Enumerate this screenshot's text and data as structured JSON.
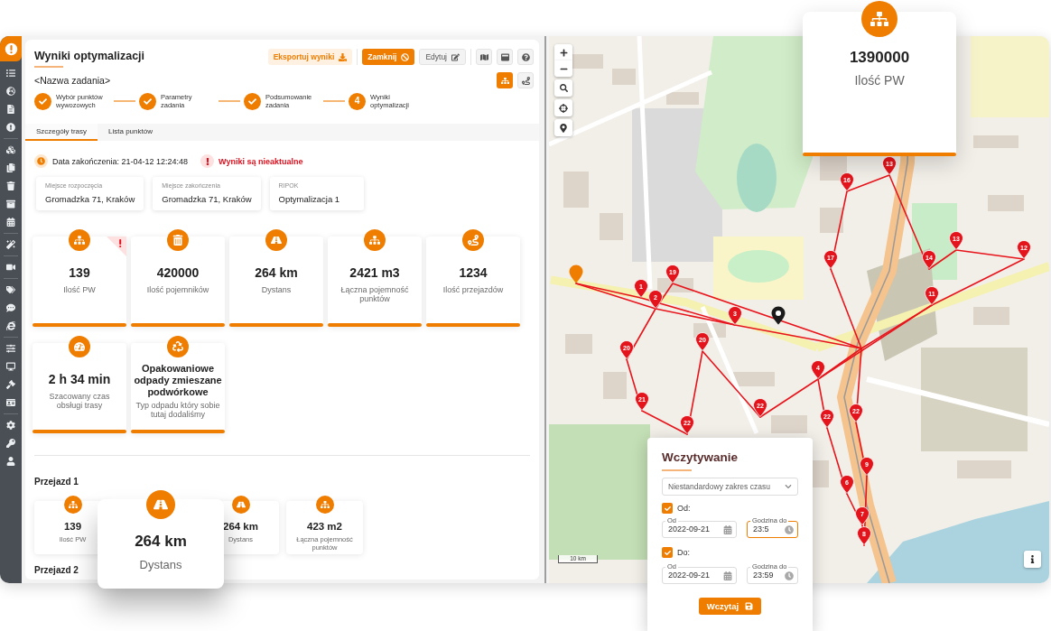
{
  "sidebar": {
    "groups": [
      {
        "items": [
          {
            "kind": "list"
          },
          {
            "kind": "globe"
          },
          {
            "kind": "file"
          },
          {
            "kind": "alert"
          }
        ]
      },
      {
        "items": [
          {
            "kind": "cubes"
          },
          {
            "kind": "copy"
          },
          {
            "kind": "trash"
          },
          {
            "kind": "archive"
          },
          {
            "kind": "calendar"
          }
        ]
      },
      {
        "items": [
          {
            "kind": "wand"
          }
        ]
      },
      {
        "items": [
          {
            "kind": "video"
          }
        ]
      },
      {
        "items": [
          {
            "kind": "tags"
          },
          {
            "kind": "comment"
          },
          {
            "kind": "e"
          }
        ]
      },
      {
        "items": [
          {
            "kind": "sliders"
          },
          {
            "kind": "monitor"
          },
          {
            "kind": "gavel"
          },
          {
            "kind": "id_card"
          }
        ]
      },
      {
        "items": [
          {
            "kind": "settings"
          },
          {
            "kind": "key"
          },
          {
            "kind": "user"
          }
        ]
      }
    ]
  },
  "popup": {
    "kind": "points",
    "value": "1390000",
    "label": "Ilość PW"
  },
  "header": {
    "title": "Wyniki optymalizacji",
    "task": "<Nazwa zadania>",
    "actions": [
      {
        "kind": "export",
        "label": "Eksportuj wyniki"
      },
      {
        "kind": "close",
        "label": "Zamknij"
      },
      {
        "kind": "edit",
        "label": "Edytuj"
      }
    ],
    "tools": [
      {
        "kind": "map"
      },
      {
        "kind": "window"
      },
      {
        "kind": "help"
      }
    ],
    "views": [
      {
        "kind": "tree",
        "selected": true
      },
      {
        "kind": "route",
        "selected": false
      }
    ]
  },
  "steps": [
    {
      "label": "Wybór punktów wywozowych",
      "done": true
    },
    {
      "label": "Parametry zadania",
      "done": true
    },
    {
      "label": "Podsumowanie zadania",
      "done": true
    },
    {
      "label": "Wyniki optymalizacji",
      "done": false,
      "number": "4"
    }
  ],
  "tabs": [
    {
      "label": "Szczegóły trasy",
      "selected": true
    },
    {
      "label": "Lista punktów",
      "selected": false
    }
  ],
  "summary": {
    "finished": "Data zakończenia: 21-04-12 12:24:48",
    "warning": "Wyniki są nieaktualne"
  },
  "places": [
    {
      "label": "Miejsce rozpoczęcia",
      "value": "Gromadzka 71, Kraków"
    },
    {
      "label": "Miejsce zakończenia",
      "value": "Gromadzka 71, Kraków"
    },
    {
      "label": "RIPOK",
      "value": "Optymalizacja 1"
    }
  ],
  "stats": [
    {
      "kind": "points",
      "value": "139",
      "label": "Ilość PW",
      "warning": true
    },
    {
      "kind": "containers",
      "value": "420000",
      "label": "Ilość pojemników",
      "warning": false
    },
    {
      "kind": "distance",
      "value": "264 km",
      "label": "Dystans",
      "warning": false
    },
    {
      "kind": "capacity",
      "value": "2421 m3",
      "label": "Łączna pojemność punktów",
      "warning": false
    },
    {
      "kind": "trips",
      "value": "1234",
      "label": "Ilość przejazdów",
      "warning": false
    },
    {
      "kind": "time",
      "value": "2 h 34 min",
      "label": "Szacowany czas obsługi trasy",
      "warning": false
    },
    {
      "kind": "waste",
      "value": "Opakowaniowe odpady zmieszane podwórkowe",
      "label": "Typ odpadu który sobie tutaj dodaliśmy",
      "warning": false
    }
  ],
  "runs": [
    {
      "title": "Przejazd 1",
      "stats": [
        {
          "kind": "points",
          "value": "139",
          "label": "Ilość PW"
        },
        {
          "kind": "distance",
          "value": "264 km",
          "label": "Dystans"
        },
        {
          "kind": "capacity",
          "value": "423 m2",
          "label": "Łączna pojemność punktów"
        }
      ]
    },
    {
      "title": "Przejazd 2"
    }
  ],
  "callout": {
    "kind": "distance",
    "value": "264 km",
    "label": "Dystans"
  },
  "map": {
    "markers": [
      {
        "label": "13"
      },
      {
        "label": "16"
      },
      {
        "label": "13"
      },
      {
        "label": "12"
      },
      {
        "label": "17"
      },
      {
        "label": "14"
      },
      {
        "label": "19"
      },
      {
        "label": "1"
      },
      {
        "label": "11"
      },
      {
        "label": "2"
      },
      {
        "label": "3"
      },
      {
        "label": "20"
      },
      {
        "label": "20"
      },
      {
        "label": "4"
      },
      {
        "label": "21"
      },
      {
        "label": "22"
      },
      {
        "label": "22"
      },
      {
        "label": "22"
      },
      {
        "label": "22"
      },
      {
        "label": "9"
      },
      {
        "label": "6"
      },
      {
        "label": "7"
      },
      {
        "label": "8"
      }
    ],
    "scale": "10 km"
  },
  "load_dialog": {
    "title": "Wczytywanie",
    "select": {
      "value": "Niestandardowy zakres czasu"
    },
    "ranges": [
      {
        "label": "Od:",
        "checked": true,
        "date": {
          "label": "Od",
          "value": "2022-09-21"
        },
        "time": {
          "label": "Godzina do",
          "value": "23:5",
          "focused": true
        }
      },
      {
        "label": "Do:",
        "checked": true,
        "date": {
          "label": "Od",
          "value": "2022-09-21"
        },
        "time": {
          "label": "Godzina do",
          "value": "23:59",
          "focused": false
        }
      }
    ],
    "button": "Wczytaj"
  }
}
